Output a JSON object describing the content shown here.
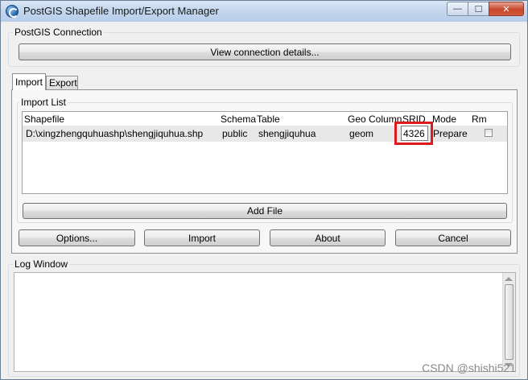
{
  "window": {
    "title": "PostGIS Shapefile Import/Export Manager",
    "minimize": "—",
    "maximize": "☐",
    "close": "✕"
  },
  "connection": {
    "legend": "PostGIS Connection",
    "view_button": "View connection details..."
  },
  "tabs": [
    {
      "label": "Import",
      "active": true
    },
    {
      "label": "Export",
      "active": false
    }
  ],
  "import_list": {
    "legend": "Import List",
    "columns": [
      "Shapefile",
      "Schema",
      "Table",
      "Geo Column",
      "SRID",
      "Mode",
      "Rm"
    ],
    "rows": [
      {
        "shapefile": "D:\\xingzhengquhuashp\\shengjiquhua.shp",
        "schema": "public",
        "table": "shengjiquhua",
        "geo_column": "geom",
        "srid": "4326",
        "mode": "Prepare",
        "rm": false
      }
    ],
    "add_file": "Add File"
  },
  "actions": {
    "options": "Options...",
    "import": "Import",
    "about": "About",
    "cancel": "Cancel"
  },
  "log": {
    "legend": "Log Window"
  },
  "watermark": "CSDN @shishi521",
  "colors": {
    "highlight": "#e01a1a"
  }
}
